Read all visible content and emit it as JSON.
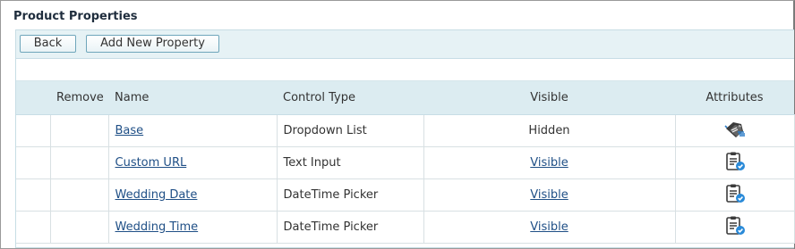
{
  "page": {
    "title": "Product Properties"
  },
  "toolbar": {
    "back_label": "Back",
    "add_label": "Add New Property"
  },
  "table": {
    "headers": {
      "remove": "Remove",
      "name": "Name",
      "control_type": "Control Type",
      "visible": "Visible",
      "attributes": "Attributes"
    },
    "rows": [
      {
        "name": "Base",
        "control_type": "Dropdown List",
        "visible": "Hidden",
        "attribute_icon": "price-tags-icon"
      },
      {
        "name": "Custom URL",
        "control_type": "Text Input",
        "visible": "Visible",
        "attribute_icon": "clipboard-edit-icon"
      },
      {
        "name": "Wedding Date",
        "control_type": "DateTime Picker",
        "visible": "Visible",
        "attribute_icon": "clipboard-edit-icon"
      },
      {
        "name": "Wedding Time",
        "control_type": "DateTime Picker",
        "visible": "Visible",
        "attribute_icon": "clipboard-edit-icon"
      }
    ]
  },
  "colors": {
    "toolbar_bg": "#e6f2f5",
    "header_bg": "#dcecf1",
    "link": "#1f4f86",
    "button_border": "#6fa6bb"
  }
}
